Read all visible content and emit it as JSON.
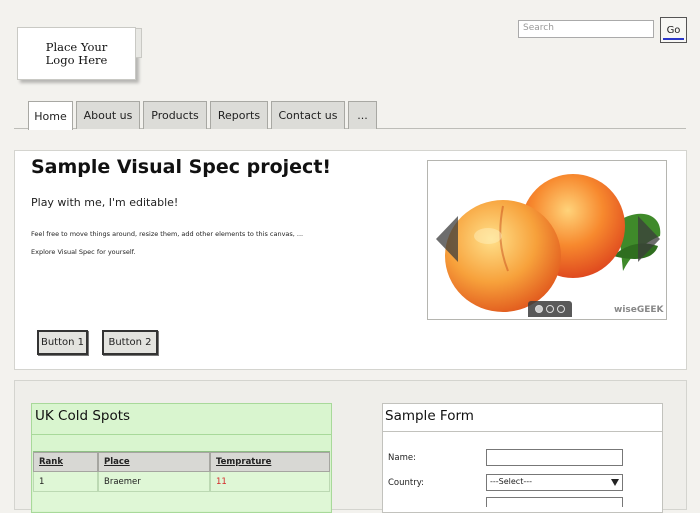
{
  "header": {
    "logo_text": "Place Your Logo Here",
    "search_placeholder": "Search",
    "go_label": "Go"
  },
  "nav": {
    "tabs": [
      {
        "label": "Home",
        "active": true
      },
      {
        "label": "About us"
      },
      {
        "label": "Products"
      },
      {
        "label": "Reports"
      },
      {
        "label": "Contact us"
      },
      {
        "label": "..."
      }
    ]
  },
  "main": {
    "title": "Sample Visual Spec project!",
    "subtitle": "Play with me, I'm editable!",
    "paragraph_1": "Feel free to move things around, resize them, add other elements to this canvas, ...",
    "paragraph_2": "Explore Visual Spec for yourself.",
    "button_1": "Button 1",
    "button_2": "Button 2"
  },
  "carousel": {
    "watermark": "wiseGEEK",
    "slide_count": 3,
    "active_slide": 1
  },
  "cold_spots": {
    "title": "UK Cold Spots",
    "columns": [
      "Rank",
      "Place",
      "Temprature"
    ],
    "rows": [
      {
        "rank": "1",
        "place": "Braemer",
        "temperature": "11"
      }
    ],
    "temperature_color": "#d42a2a"
  },
  "form": {
    "title": "Sample Form",
    "name_label": "Name:",
    "country_label": "Country:",
    "country_selected": "---Select---"
  }
}
